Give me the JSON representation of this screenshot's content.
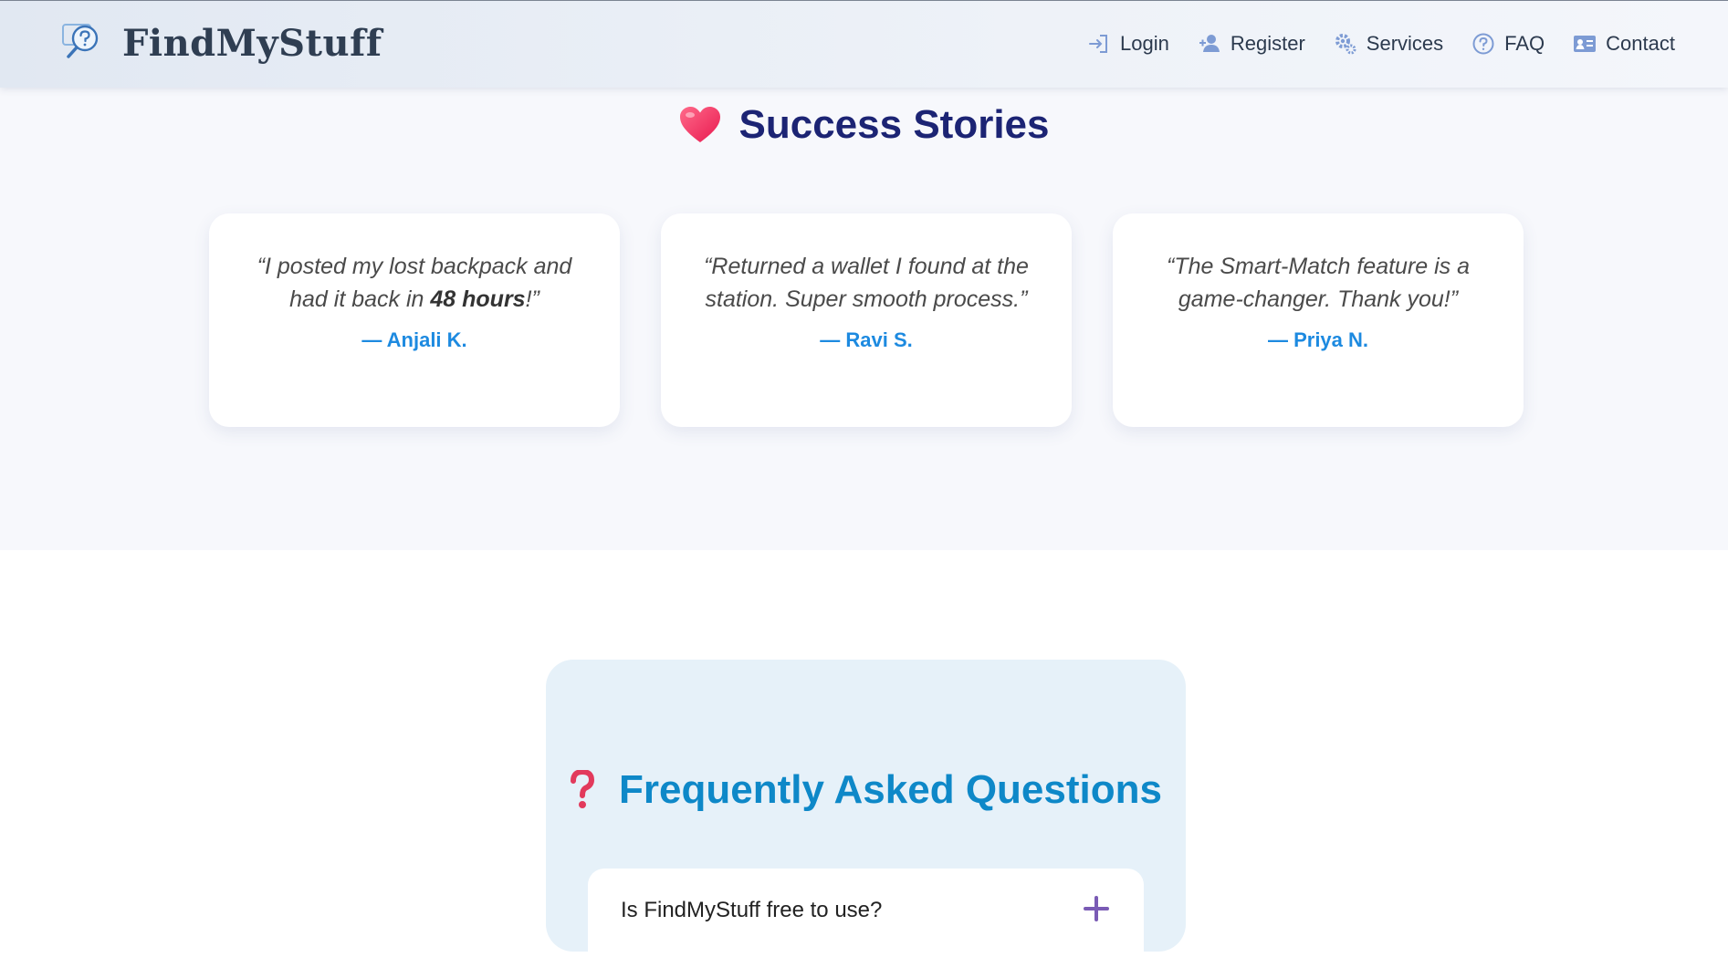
{
  "brand": {
    "name": "FindMyStuff",
    "icon": "search-question-icon"
  },
  "nav": {
    "items": [
      {
        "label": "Login",
        "icon": "login-icon"
      },
      {
        "label": "Register",
        "icon": "user-add-icon"
      },
      {
        "label": "Services",
        "icon": "gears-icon"
      },
      {
        "label": "FAQ",
        "icon": "question-circle-icon"
      },
      {
        "label": "Contact",
        "icon": "contact-card-icon"
      }
    ]
  },
  "stories": {
    "heading": "Success Stories",
    "icon": "heart-icon",
    "cards": [
      {
        "quote_before": "“I posted my lost backpack and had it back in ",
        "quote_bold": "48 hours",
        "quote_after": "!”",
        "author": "— Anjali K."
      },
      {
        "quote": "“Returned a wallet I found at the station. Super smooth process.”",
        "author": "— Ravi S."
      },
      {
        "quote": "“The Smart-Match feature is a game-changer. Thank you!”",
        "author": "— Priya N."
      }
    ]
  },
  "faq": {
    "heading": "Frequently Asked Questions",
    "icon": "question-mark-icon",
    "items": [
      {
        "question": "Is FindMyStuff free to use?",
        "toggle_icon": "plus-icon"
      }
    ]
  },
  "colors": {
    "navy": "#1c2474",
    "accent_blue": "#1d8ae0",
    "faq_blue": "#0e88c8",
    "plus_purple": "#7a5bb5"
  }
}
